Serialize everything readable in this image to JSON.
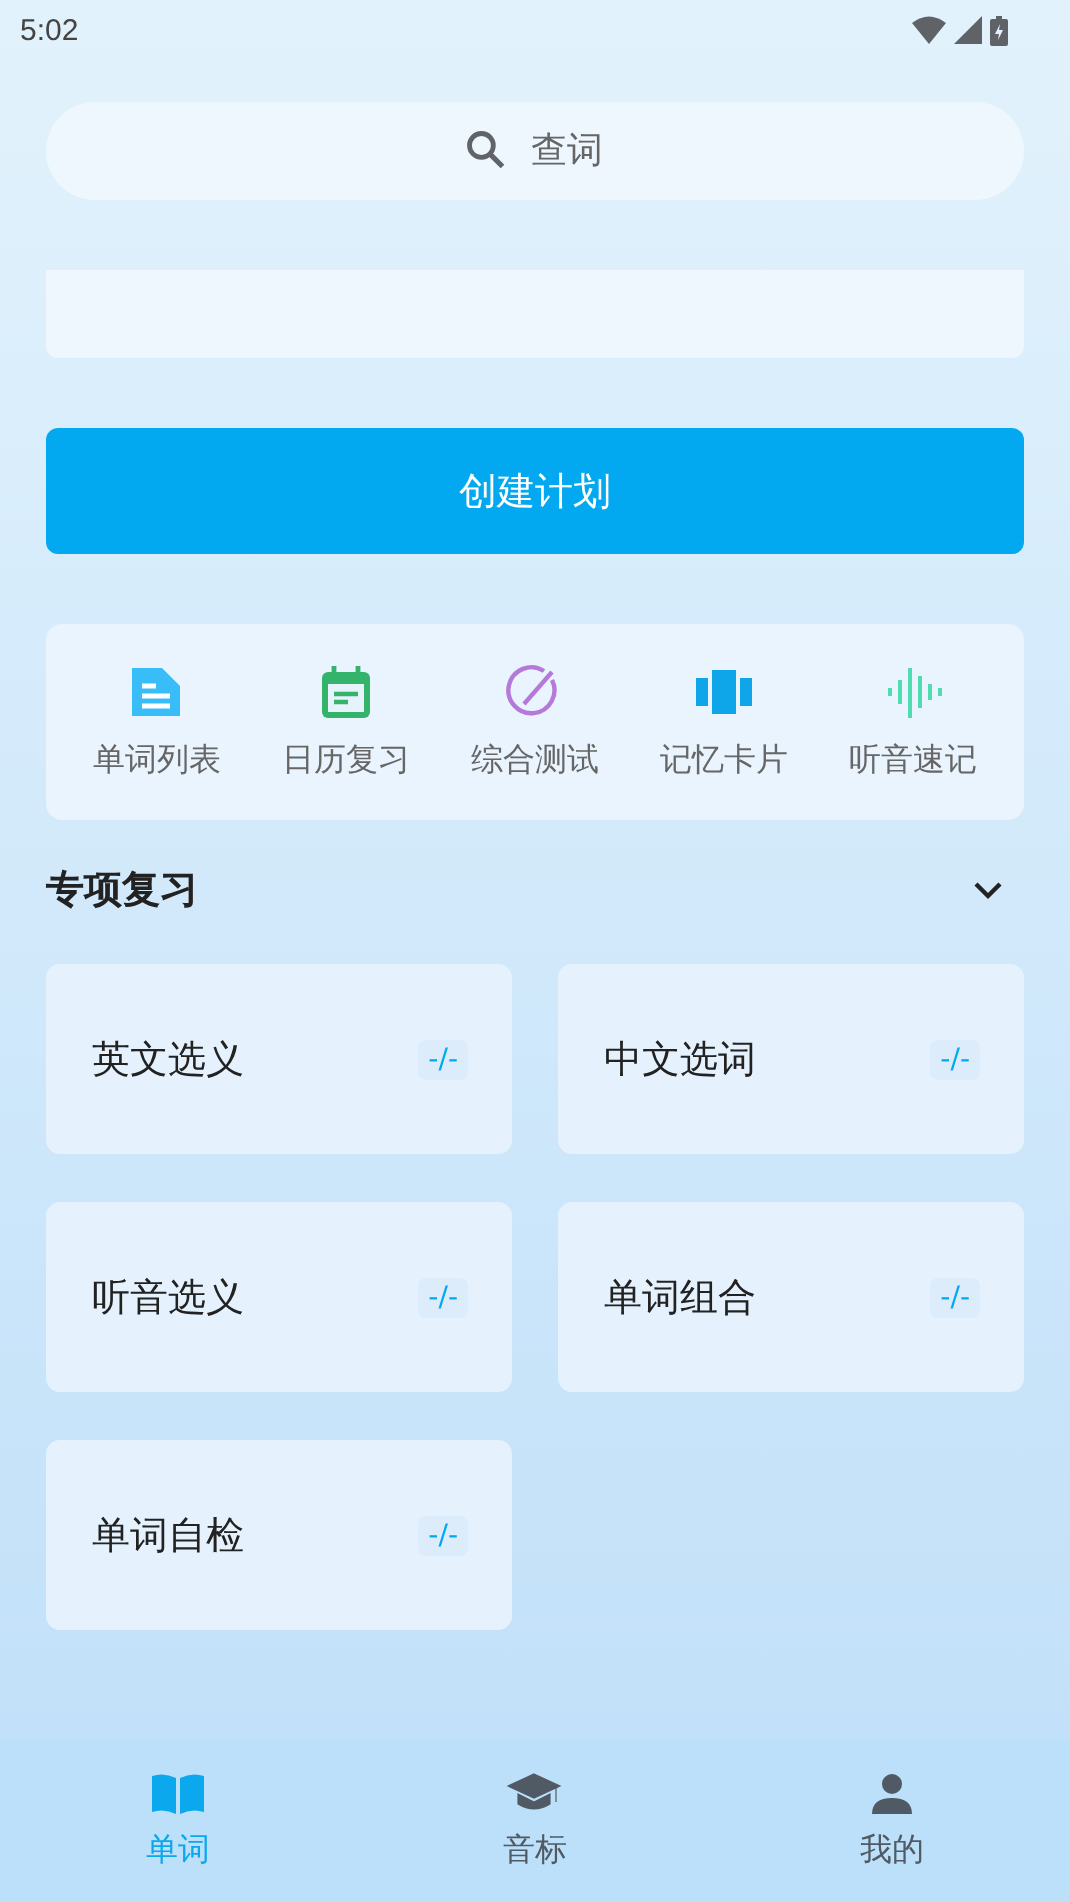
{
  "status_bar": {
    "time": "5:02"
  },
  "search": {
    "placeholder": "查词"
  },
  "plan_button": {
    "label": "创建计划"
  },
  "tools": [
    {
      "kind": "doc",
      "label": "单词列表",
      "color": "#38bdf8"
    },
    {
      "kind": "calendar",
      "label": "日历复习",
      "color": "#34b36b"
    },
    {
      "kind": "pen",
      "label": "综合测试",
      "color": "#b57ad9"
    },
    {
      "kind": "cards",
      "label": "记忆卡片",
      "color": "#0ea5e9"
    },
    {
      "kind": "wave",
      "label": "听音速记",
      "color": "#4fdcb0"
    }
  ],
  "section": {
    "title": "专项复习",
    "expanded": true
  },
  "review_cards": [
    {
      "label": "英文选义",
      "score": "-/-"
    },
    {
      "label": "中文选词",
      "score": "-/-"
    },
    {
      "label": "听音选义",
      "score": "-/-"
    },
    {
      "label": "单词组合",
      "score": "-/-"
    },
    {
      "label": "单词自检",
      "score": "-/-"
    }
  ],
  "bottom_nav": [
    {
      "kind": "book",
      "label": "单词",
      "selected": true
    },
    {
      "kind": "cap",
      "label": "音标",
      "selected": false
    },
    {
      "kind": "person",
      "label": "我的",
      "selected": false
    }
  ]
}
